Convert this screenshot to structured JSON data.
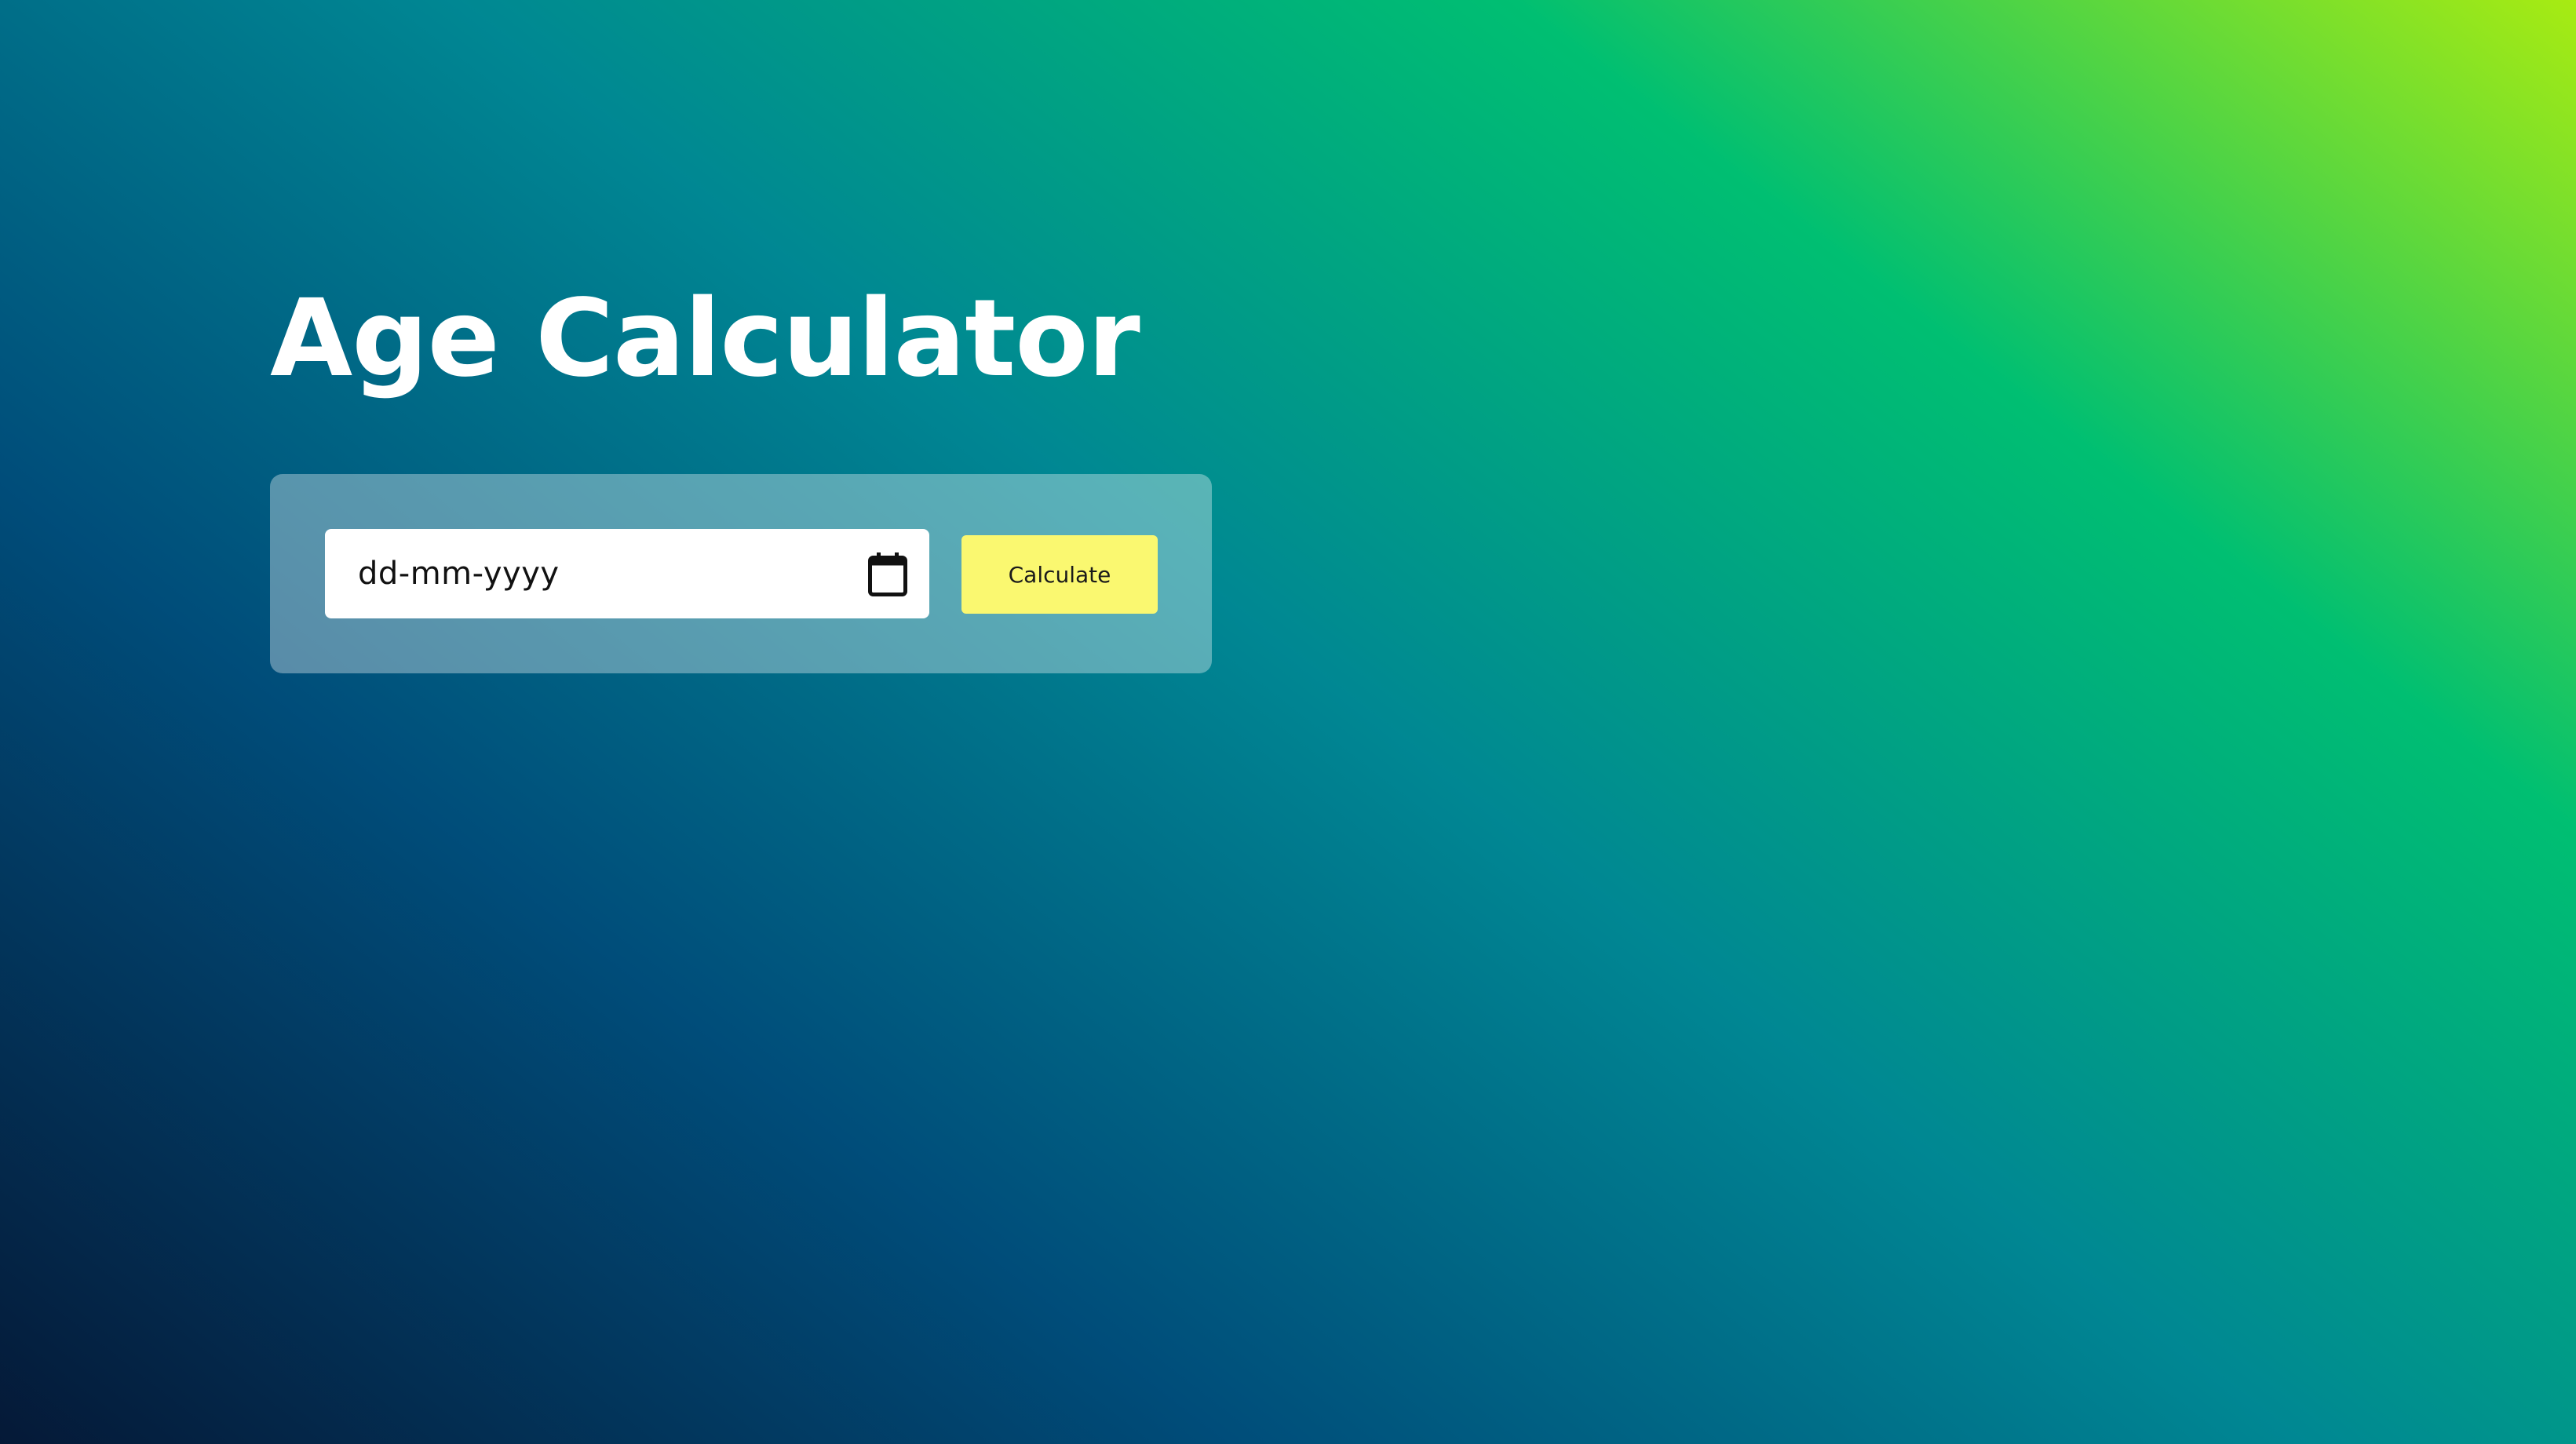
{
  "header": {
    "title": "Age Calculator"
  },
  "form": {
    "date_input": {
      "placeholder": "dd-mm-yyyy",
      "value": ""
    },
    "calculate_label": "Calculate"
  },
  "icons": {
    "calendar": "calendar-icon"
  },
  "colors": {
    "gradient": [
      "#051937",
      "#004d7a",
      "#008793",
      "#00bf72",
      "#a8eb12"
    ],
    "button_bg": "#faf870",
    "title_text": "#ffffff"
  }
}
